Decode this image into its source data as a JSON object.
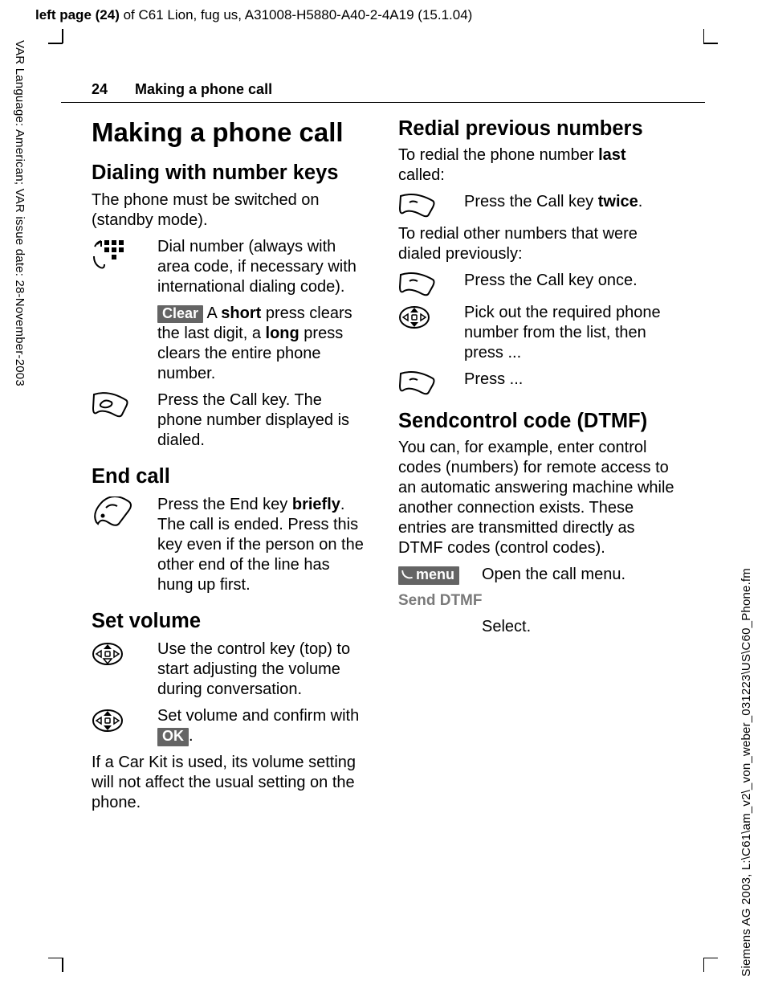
{
  "meta": {
    "header_prefix": "left page (24)",
    "header_rest": " of C61 Lion, fug us, A31008-H5880-A40-2-4A19 (15.1.04)",
    "side_left": "VAR Language: American; VAR issue date: 28-November-2003",
    "side_right": "Siemens AG 2003, L:\\C61\\am_v2\\_von_weber_031223\\US\\C60_Phone.fm"
  },
  "running": {
    "pagenum": "24",
    "title": "Making a phone call"
  },
  "left": {
    "h1": "Making a phone call",
    "h2a": "Dialing with number keys",
    "intro": "The phone must be switched on (standby mode).",
    "dial_text": "Dial number (always with area code, if necessary with international dialing code).",
    "clear_label": "Clear",
    "clear_pre": " A ",
    "clear_bold1": "short",
    "clear_mid": " press clears the last digit, a ",
    "clear_bold2": "long",
    "clear_post": " press clears the entire phone number.",
    "call_text": "Press the Call key. The phone number displayed is dialed.",
    "h2b": "End call",
    "end_pre": "Press the End key ",
    "end_bold": "briefly",
    "end_post": ". The call is ended. Press this key even if the person on the other end of the line has hung up first.",
    "h2c": "Set volume",
    "vol1": "Use the control key (top) to start adjusting the vol­ume during conversation.",
    "vol2_pre": "Set volume and confirm with ",
    "ok_label": "OK",
    "vol2_post": ".",
    "carkit": "If a Car Kit is used, its volume setting will not affect the usual setting on the phone."
  },
  "right": {
    "h2a": "Redial previous numbers",
    "intro_pre": "To redial the phone number ",
    "intro_bold": "last",
    "intro_post": " called:",
    "twice_pre": "Press the Call key ",
    "twice_bold": "twice",
    "twice_post": ".",
    "other": "To redial other numbers that were dialed previously:",
    "once": "Press the Call key once.",
    "pick": "Pick out the required phone number from the list, then press ...",
    "press": "Press ...",
    "h2b": "Sendcontrol code (DTMF)",
    "dtmf_body": "You can, for example, enter control codes (numbers) for remote access to an automatic answering machine while another connection exists. These entries are transmitted directly as DTMF codes (control codes).",
    "menu_label": "menu",
    "open_menu": "Open the call menu.",
    "send_dtmf": "Send DTMF",
    "select": "Select."
  }
}
